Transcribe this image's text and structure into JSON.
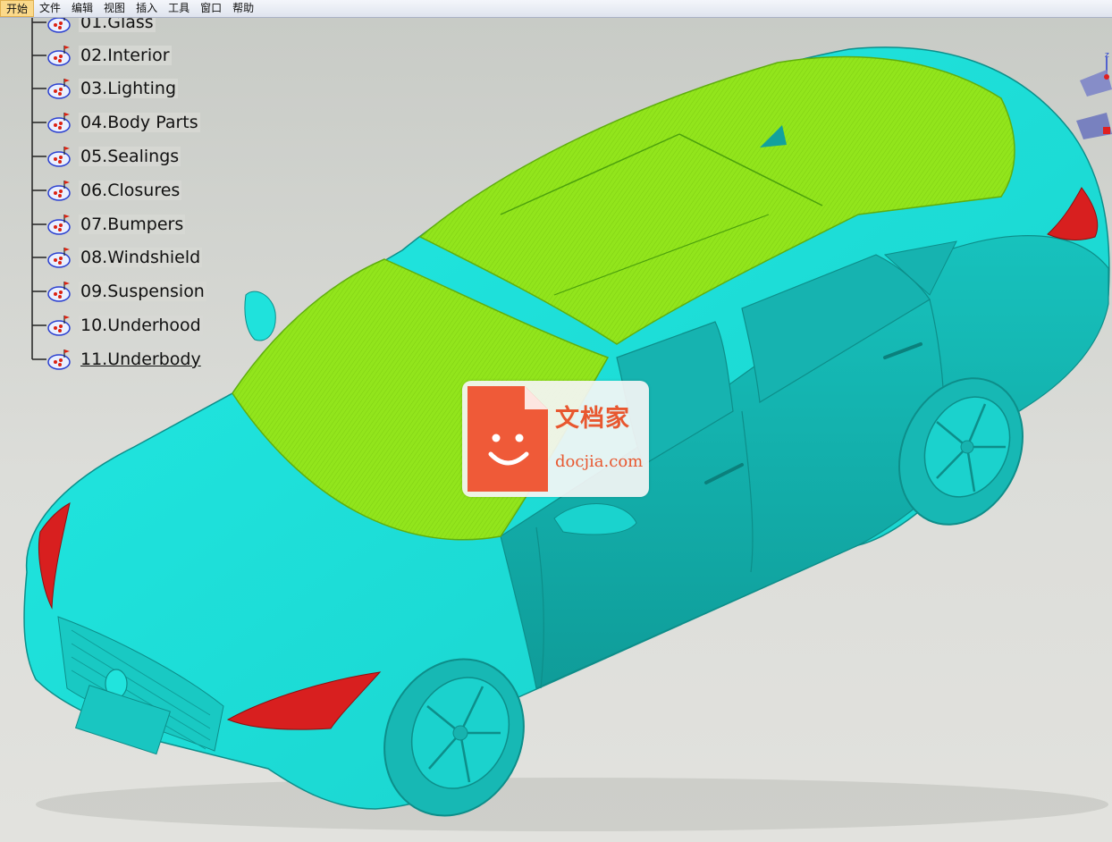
{
  "menubar": {
    "items": [
      "开始",
      "文件",
      "编辑",
      "视图",
      "插入",
      "工具",
      "窗口",
      "帮助"
    ],
    "active": "开始"
  },
  "tree": {
    "items": [
      "01.Glass",
      "02.Interior",
      "03.Lighting",
      "04.Body Parts",
      "05.Sealings",
      "06.Closures",
      "07.Bumpers",
      "08.Windshield",
      "09.Suspension",
      "10.Underhood",
      "11.Underbody"
    ],
    "icon": "product-node-icon"
  },
  "compass": {
    "axis_label": "z",
    "icon": "compass-icon"
  },
  "watermark": {
    "name": "文档家",
    "url": "docjia.com",
    "icon": "document-smile-icon"
  },
  "colors": {
    "body": "#1cded8",
    "body_shadow": "#14a9a6",
    "glass": "#8fe51a",
    "lights": "#d81f1f",
    "brand": "#e8572f"
  }
}
